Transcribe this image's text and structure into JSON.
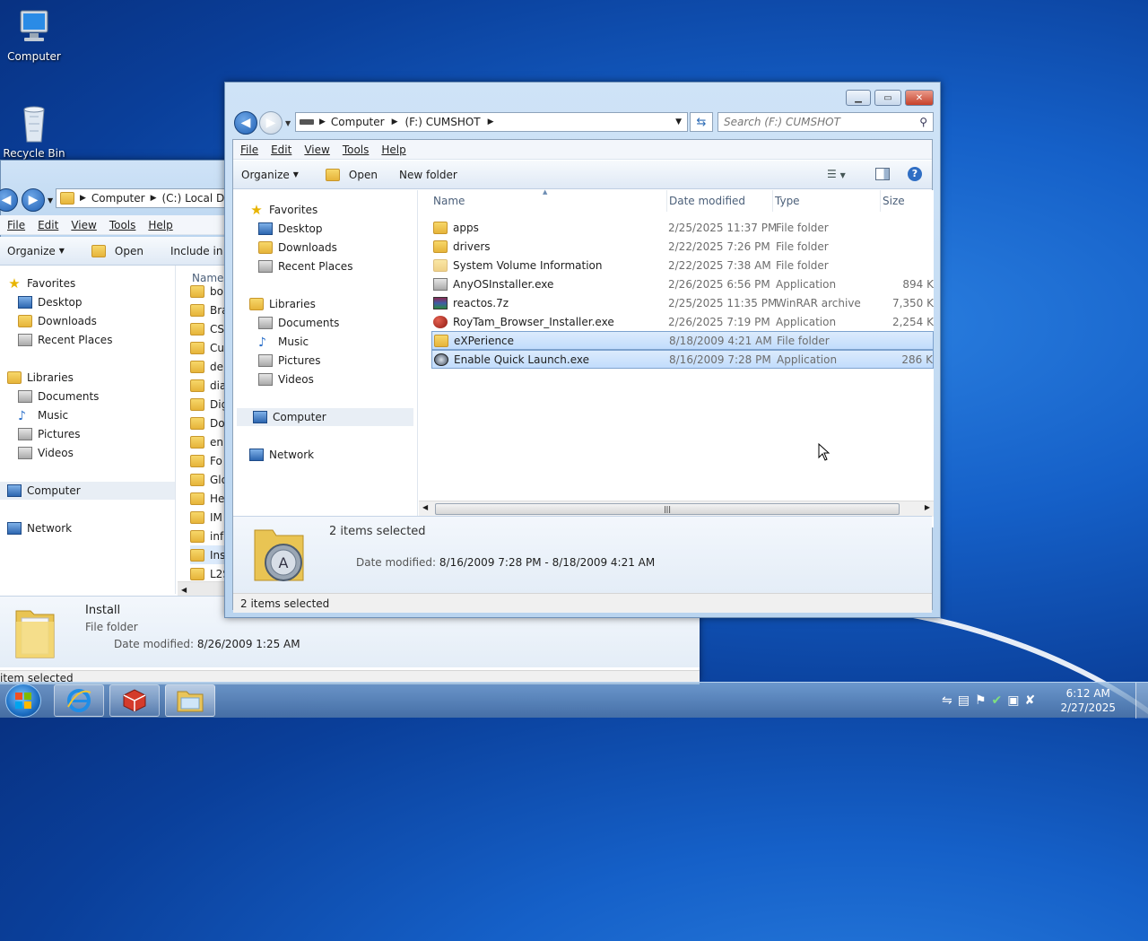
{
  "desktop": {
    "icons": [
      {
        "label": "Computer"
      },
      {
        "label": "Recycle Bin"
      }
    ]
  },
  "back_window": {
    "address": [
      "Computer",
      "(C:) Local Disk"
    ],
    "menu": [
      "File",
      "Edit",
      "View",
      "Tools",
      "Help"
    ],
    "commands": {
      "organize": "Organize",
      "open": "Open",
      "include": "Include in library"
    },
    "nav": {
      "favorites": "Favorites",
      "desktop": "Desktop",
      "downloads": "Downloads",
      "recent": "Recent Places",
      "libraries": "Libraries",
      "documents": "Documents",
      "music": "Music",
      "pictures": "Pictures",
      "videos": "Videos",
      "computer": "Computer",
      "network": "Network"
    },
    "column_name": "Name",
    "items": [
      "bo",
      "Bra",
      "CS",
      "Cu",
      "de",
      "dia",
      "Dig",
      "Do",
      "en",
      "Fo",
      "Glo",
      "He",
      "IM",
      "inf",
      "Ins",
      "L2S"
    ],
    "details": {
      "name": "Install",
      "type": "File folder",
      "date_label": "Date modified:",
      "date_value": "8/26/2009 1:25 AM"
    },
    "status": "item selected"
  },
  "front_window": {
    "address": [
      "Computer",
      "(F:) CUMSHOT"
    ],
    "search_placeholder": "Search (F:) CUMSHOT",
    "menu": [
      "File",
      "Edit",
      "View",
      "Tools",
      "Help"
    ],
    "commands": {
      "organize": "Organize",
      "open": "Open",
      "new_folder": "New folder"
    },
    "nav": {
      "favorites": "Favorites",
      "desktop": "Desktop",
      "downloads": "Downloads",
      "recent": "Recent Places",
      "libraries": "Libraries",
      "documents": "Documents",
      "music": "Music",
      "pictures": "Pictures",
      "videos": "Videos",
      "computer": "Computer",
      "network": "Network"
    },
    "columns": [
      "Name",
      "Date modified",
      "Type",
      "Size"
    ],
    "files": [
      {
        "name": "apps",
        "date": "2/25/2025 11:37 PM",
        "type": "File folder",
        "size": "",
        "icon": "folder",
        "selected": false
      },
      {
        "name": "drivers",
        "date": "2/22/2025 7:26 PM",
        "type": "File folder",
        "size": "",
        "icon": "folder",
        "selected": false
      },
      {
        "name": "System Volume Information",
        "date": "2/22/2025 7:38 AM",
        "type": "File folder",
        "size": "",
        "icon": "folder-light",
        "selected": false
      },
      {
        "name": "AnyOSInstaller.exe",
        "date": "2/26/2025 6:56 PM",
        "type": "Application",
        "size": "894 K",
        "icon": "exe",
        "selected": false
      },
      {
        "name": "reactos.7z",
        "date": "2/25/2025 11:35 PM",
        "type": "WinRAR archive",
        "size": "7,350 K",
        "icon": "rar",
        "selected": false
      },
      {
        "name": "RoyTam_Browser_Installer.exe",
        "date": "2/26/2025 7:19 PM",
        "type": "Application",
        "size": "2,254 K",
        "icon": "red-ball",
        "selected": false
      },
      {
        "name": "eXPerience",
        "date": "8/18/2009 4:21 AM",
        "type": "File folder",
        "size": "",
        "icon": "folder",
        "selected": true
      },
      {
        "name": "Enable Quick Launch.exe",
        "date": "8/16/2009 7:28 PM",
        "type": "Application",
        "size": "286 K",
        "icon": "app-circle",
        "selected": true
      }
    ],
    "details": {
      "count": "2 items selected",
      "date_label": "Date modified:",
      "date_value": "8/16/2009 7:28 PM - 8/18/2009 4:21 AM"
    },
    "status": "2 items selected"
  },
  "taskbar": {
    "time": "6:12 AM",
    "date": "2/27/2025"
  }
}
